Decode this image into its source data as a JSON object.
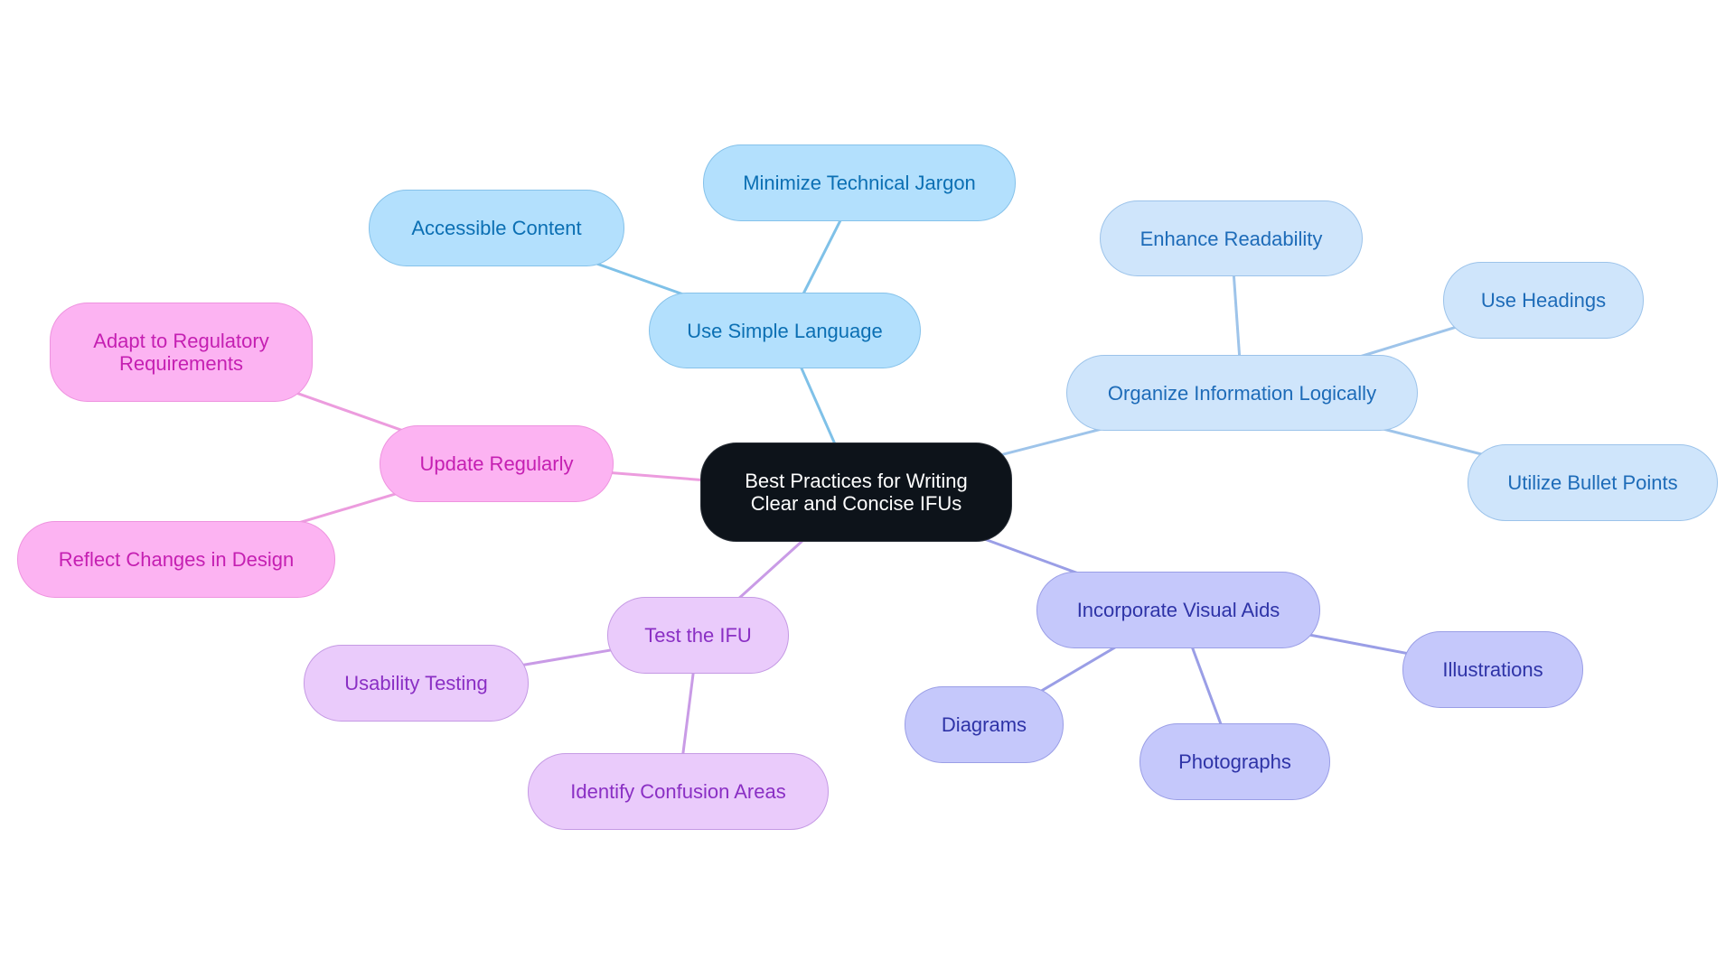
{
  "diagram": {
    "type": "mindmap",
    "root": {
      "id": "root",
      "label": "Best Practices for Writing\nClear and Concise IFUs"
    },
    "branches": [
      {
        "id": "use-simple-language",
        "label": "Use Simple Language",
        "color": "#b3e0fd",
        "children": [
          {
            "id": "minimize-technical-jargon",
            "label": "Minimize Technical Jargon"
          },
          {
            "id": "accessible-content",
            "label": "Accessible Content"
          }
        ]
      },
      {
        "id": "organize-information-logically",
        "label": "Organize Information Logically",
        "color": "#cfe5fb",
        "children": [
          {
            "id": "enhance-readability",
            "label": "Enhance Readability"
          },
          {
            "id": "use-headings",
            "label": "Use Headings"
          },
          {
            "id": "utilize-bullet-points",
            "label": "Utilize Bullet Points"
          }
        ]
      },
      {
        "id": "incorporate-visual-aids",
        "label": "Incorporate Visual Aids",
        "color": "#c5c8fb",
        "children": [
          {
            "id": "diagrams",
            "label": "Diagrams"
          },
          {
            "id": "photographs",
            "label": "Photographs"
          },
          {
            "id": "illustrations",
            "label": "Illustrations"
          }
        ]
      },
      {
        "id": "test-the-ifu",
        "label": "Test the IFU",
        "color": "#eacbfb",
        "children": [
          {
            "id": "usability-testing",
            "label": "Usability Testing"
          },
          {
            "id": "identify-confusion-areas",
            "label": "Identify Confusion Areas"
          }
        ]
      },
      {
        "id": "update-regularly",
        "label": "Update Regularly",
        "color": "#fcb3f2",
        "children": [
          {
            "id": "adapt-to-regulatory-requirements",
            "label": "Adapt to Regulatory\nRequirements"
          },
          {
            "id": "reflect-changes-in-design",
            "label": "Reflect Changes in Design"
          }
        ]
      }
    ],
    "edge_colors": {
      "use-simple-language": "#7fc1e8",
      "organize-information-logically": "#9ec4ea",
      "incorporate-visual-aids": "#9a9ee6",
      "test-the-ifu": "#c99be6",
      "update-regularly": "#ec9cde"
    }
  }
}
